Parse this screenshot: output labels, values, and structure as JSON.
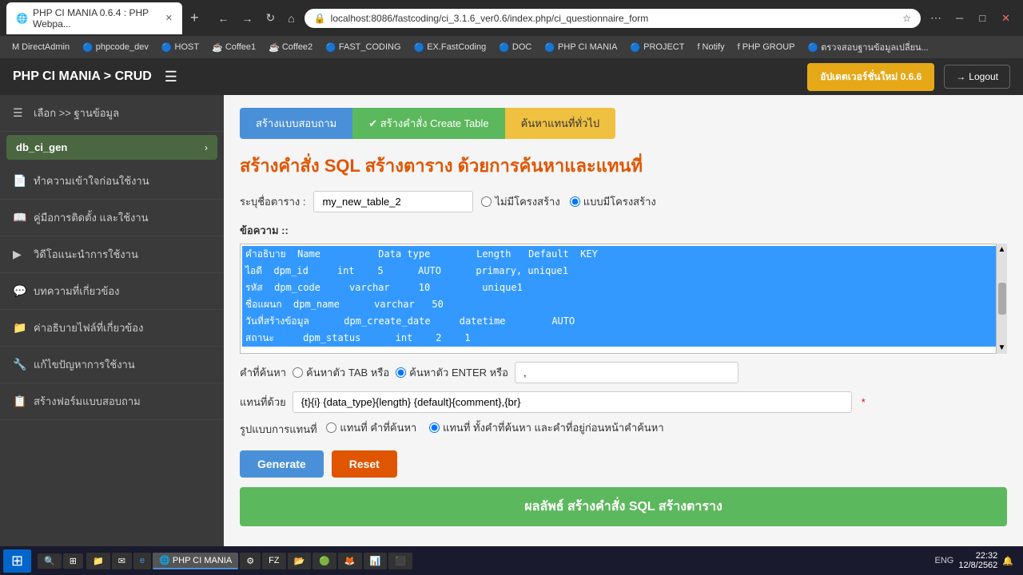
{
  "browser": {
    "tab_title": "PHP CI MANIA 0.6.4 : PHP Webpa...",
    "url": "localhost:8086/fastcoding/ci_3.1.6_ver0.6/index.php/ci_questionnaire_form",
    "new_tab_icon": "+",
    "back_icon": "←",
    "forward_icon": "→",
    "refresh_icon": "↻",
    "home_icon": "⌂",
    "lock_icon": "🔒",
    "star_icon": "☆",
    "settings_icon": "⋯",
    "window_min": "─",
    "window_max": "□",
    "window_close": "✕"
  },
  "bookmarks": [
    {
      "label": "DirectAdmin",
      "icon": "M"
    },
    {
      "label": "phpcode_dev",
      "icon": "🔵"
    },
    {
      "label": "HOST",
      "icon": "🔵"
    },
    {
      "label": "Coffee1",
      "icon": "☕"
    },
    {
      "label": "Coffee2",
      "icon": "☕"
    },
    {
      "label": "FAST_CODING",
      "icon": "🔵"
    },
    {
      "label": "EX.FastCoding",
      "icon": "🔵"
    },
    {
      "label": "DOC",
      "icon": "🔵"
    },
    {
      "label": "PHP CI MANIA",
      "icon": "🔵"
    },
    {
      "label": "PROJECT",
      "icon": "🔵"
    },
    {
      "label": "Notify",
      "icon": "f"
    },
    {
      "label": "PHP GROUP",
      "icon": "f"
    },
    {
      "label": "ตรวจสอบฐานข้อมูลเปลี่ยน...",
      "icon": "🔵"
    }
  ],
  "header": {
    "title": "PHP CI MANIA > CRUD",
    "hamburger": "☰",
    "update_btn": "อัปเดตเวอร์ชั่นใหม่ 0.6.6",
    "logout_btn": "Logout",
    "logout_icon": "→"
  },
  "sidebar": {
    "items": [
      {
        "icon": "☰",
        "label": "เลือก >> ฐานข้อมูล"
      },
      {
        "icon": "📁",
        "label": "db_ci_gen",
        "is_db": true
      },
      {
        "icon": "📄",
        "label": "ทำความเข้าใจก่อนใช้งาน"
      },
      {
        "icon": "📖",
        "label": "คู่มือการติดตั้ง และใช้งาน"
      },
      {
        "icon": "▶",
        "label": "วิดีโอแนะนำการใช้งาน"
      },
      {
        "icon": "💬",
        "label": "บทความที่เกี่ยวข้อง"
      },
      {
        "icon": "📁",
        "label": "ค่าอธิบายไฟล์ที่เกี่ยวข้อง"
      },
      {
        "icon": "🔧",
        "label": "แก้ไขปัญหาการใช้งาน"
      },
      {
        "icon": "📋",
        "label": "สร้างฟอร์มแบบสอบถาม"
      }
    ]
  },
  "tabs": [
    {
      "label": "สร้างแบบสอบถาม",
      "style": "blue"
    },
    {
      "label": "✔ สร้างคำสั่ง Create Table",
      "style": "green"
    },
    {
      "label": "ค้นหาแทนที่ทั่วไป",
      "style": "yellow"
    }
  ],
  "page": {
    "title": "สร้างคำสั่ง SQL สร้างตาราง ด้วยการค้นหาและแทนที่",
    "table_label": "ระบุชื่อตาราง :",
    "table_input_value": "my_new_table_2",
    "radio_no_structure": "ไม่มีโครงสร้าง",
    "radio_with_structure": "แบบมีโครงสร้าง",
    "content_label": "ข้อความ ::",
    "content_rows": [
      {
        "text": "คำอธิบาย  Name          Data type        Length   Default  KEY",
        "selected": true
      },
      {
        "text": "ไอดี  dpm_id     int    5      AUTO      primary, unique1",
        "selected": true
      },
      {
        "text": "รหัส  dpm_code     varchar     10         unique1",
        "selected": true
      },
      {
        "text": "ชื่อแผนก  dpm_name      varchar   50",
        "selected": true
      },
      {
        "text": "วันที่สร้างข้อมูล      dpm_create_date     datetime        AUTO",
        "selected": true
      },
      {
        "text": "สถานะ      dpm_status      int    2    1",
        "selected": true
      }
    ],
    "search_label": "คำที่ค้นหา",
    "radio_search_tab": "ค้นหาตัว TAB หรือ",
    "radio_search_enter": "ค้นหาตัว ENTER หรือ",
    "search_separator_value": ",",
    "replace_label": "แทนที่ด้วย",
    "replace_placeholder": "{t}{i} {data_type}{length} {default}{comment},{br}",
    "replace_value": "{t}{i} {data_type}{length} {default}{comment},{br}",
    "pattern_label": "รูปแบบการแทนที่",
    "radio_pattern1": "แทนที่ คำที่ค้นหา",
    "radio_pattern2": "แทนที่ ทั้งคำที่ค้นหา และคำที่อยู่ก่อนหน้าคำค้นหา",
    "btn_generate": "Generate",
    "btn_reset": "Reset",
    "result_banner": "ผลลัพธ์ สร้างคำสั่ง SQL สร้างตาราง"
  },
  "taskbar": {
    "clock": "22:32",
    "date": "12/8/2562",
    "lang": "ENG"
  }
}
